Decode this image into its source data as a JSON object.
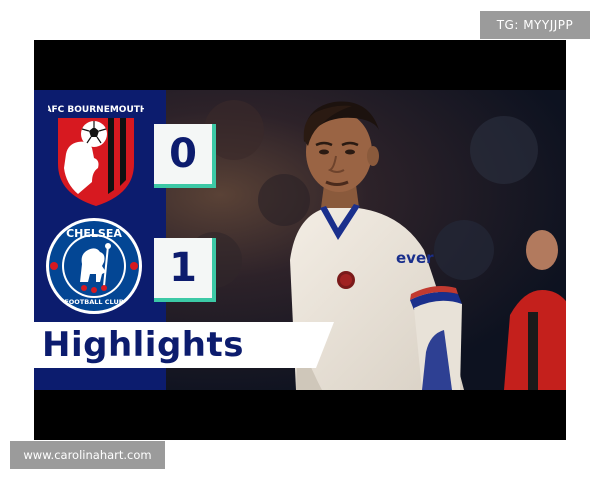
{
  "watermark": {
    "top_right": "TG: MYYJJPP",
    "bottom_left": "www.carolinahart.com"
  },
  "match": {
    "home_team": "AFC BOURNEMOUTH",
    "home_score": "0",
    "away_team": "CHELSEA",
    "away_crest_bottom": "FOOTBALL CLUB",
    "away_score": "1",
    "banner": "Highlights"
  },
  "shirt": {
    "sponsor": "ever"
  },
  "colors": {
    "panel_blue": "#0c1c6e",
    "score_accent": "#3cc9a6",
    "bournemouth_red": "#d71920",
    "chelsea_blue": "#034694"
  },
  "icons": {
    "home_crest": "afc-bournemouth-crest-icon",
    "away_crest": "chelsea-crest-icon"
  }
}
